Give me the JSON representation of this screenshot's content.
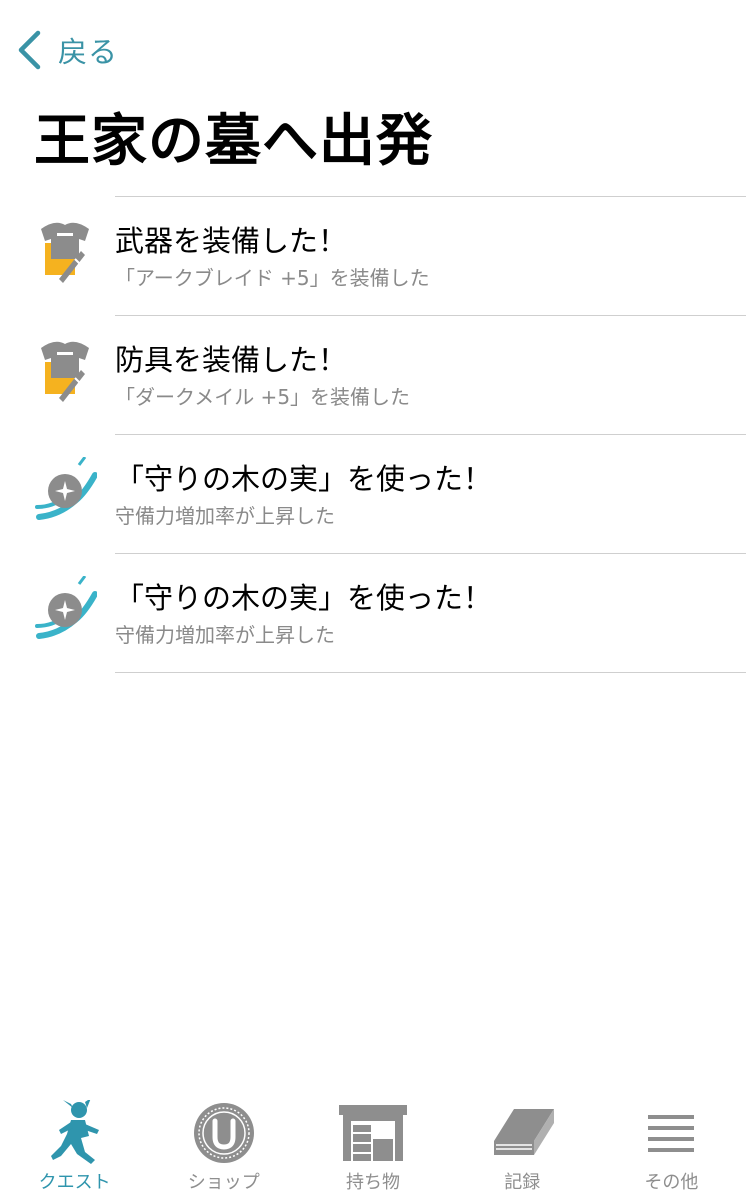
{
  "nav": {
    "back_label": "戻る"
  },
  "page": {
    "title": "王家の墓へ出発"
  },
  "log": [
    {
      "icon": "equip-icon",
      "title": "武器を装備した！",
      "subtitle": "「アークブレイド +5」を装備した"
    },
    {
      "icon": "equip-icon",
      "title": "防具を装備した！",
      "subtitle": "「ダークメイル +5」を装備した"
    },
    {
      "icon": "item-use-icon",
      "title": "「守りの木の実」を使った！",
      "subtitle": "守備力増加率が上昇した"
    },
    {
      "icon": "item-use-icon",
      "title": "「守りの木の実」を使った！",
      "subtitle": "守備力増加率が上昇した"
    }
  ],
  "tabs": [
    {
      "label": "クエスト",
      "icon": "running-hero-icon",
      "active": true
    },
    {
      "label": "ショップ",
      "icon": "coin-icon",
      "active": false
    },
    {
      "label": "持ち物",
      "icon": "storehouse-icon",
      "active": false
    },
    {
      "label": "記録",
      "icon": "book-icon",
      "active": false
    },
    {
      "label": "その他",
      "icon": "menu-icon",
      "active": false
    }
  ],
  "colors": {
    "accent": "#3a93a6",
    "tab_active": "#2f95ad",
    "tab_inactive": "#8e8e8e",
    "subtitle": "#8a8a8a",
    "equip_yellow": "#f5b21f"
  }
}
